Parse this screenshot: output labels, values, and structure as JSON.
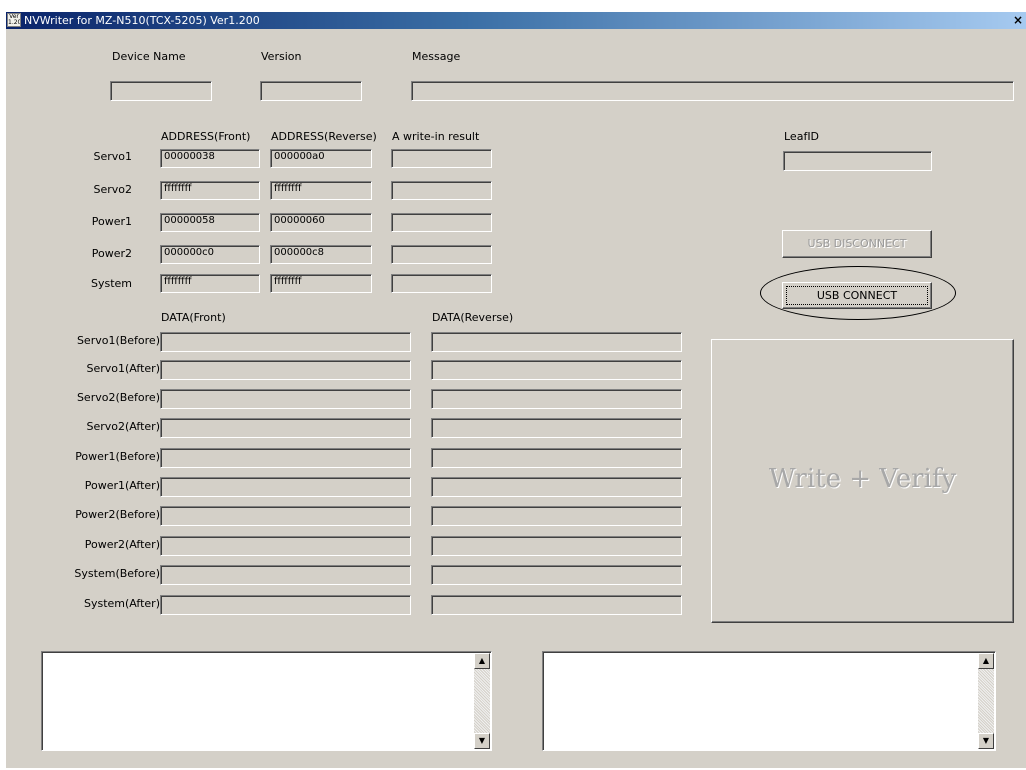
{
  "window": {
    "title": "NVWriter for MZ-N510(TCX-5205) Ver1.200",
    "icon_text": "Ver 1.20",
    "close_glyph": "×"
  },
  "header": {
    "device_name_label": "Device Name",
    "version_label": "Version",
    "message_label": "Message",
    "device_name_value": "",
    "version_value": "",
    "message_value": ""
  },
  "address": {
    "col_front": "ADDRESS(Front)",
    "col_reverse": "ADDRESS(Reverse)",
    "col_result": "A write-in result",
    "rows": [
      {
        "label": "Servo1",
        "front": "00000038",
        "reverse": "000000a0",
        "result": ""
      },
      {
        "label": "Servo2",
        "front": "ffffffff",
        "reverse": "ffffffff",
        "result": ""
      },
      {
        "label": "Power1",
        "front": "00000058",
        "reverse": "00000060",
        "result": ""
      },
      {
        "label": "Power2",
        "front": "000000c0",
        "reverse": "000000c8",
        "result": ""
      },
      {
        "label": "System",
        "front": "ffffffff",
        "reverse": "ffffffff",
        "result": ""
      }
    ]
  },
  "leaf": {
    "label": "LeafID",
    "value": ""
  },
  "buttons": {
    "usb_disconnect": "USB DISCONNECT",
    "usb_connect": "USB CONNECT",
    "write_verify": "Write + Verify"
  },
  "data": {
    "col_front": "DATA(Front)",
    "col_reverse": "DATA(Reverse)",
    "rows": [
      {
        "label": "Servo1(Before)",
        "front": "",
        "reverse": ""
      },
      {
        "label": "Servo1(After)",
        "front": "",
        "reverse": ""
      },
      {
        "label": "Servo2(Before)",
        "front": "",
        "reverse": ""
      },
      {
        "label": "Servo2(After)",
        "front": "",
        "reverse": ""
      },
      {
        "label": "Power1(Before)",
        "front": "",
        "reverse": ""
      },
      {
        "label": "Power1(After)",
        "front": "",
        "reverse": ""
      },
      {
        "label": "Power2(Before)",
        "front": "",
        "reverse": ""
      },
      {
        "label": "Power2(After)",
        "front": "",
        "reverse": ""
      },
      {
        "label": "System(Before)",
        "front": "",
        "reverse": ""
      },
      {
        "label": "System(After)",
        "front": "",
        "reverse": ""
      }
    ]
  },
  "logs": {
    "left": "",
    "right": "",
    "scroll_up_glyph": "▲",
    "scroll_down_glyph": "▼"
  },
  "icons": {
    "app": "nvwriter-app-icon",
    "close": "close-icon",
    "scroll_up": "arrow-up-icon",
    "scroll_down": "arrow-down-icon"
  },
  "colors": {
    "face": "#d4d0c8",
    "title_start": "#0a246a",
    "title_end": "#a6caf0",
    "disabled_text": "#9a9a9a"
  }
}
